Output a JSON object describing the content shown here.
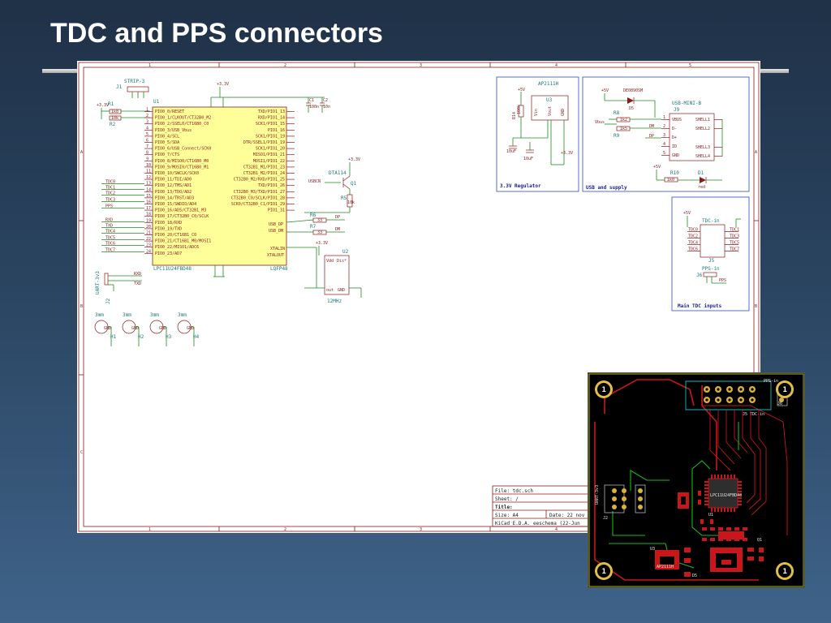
{
  "slide": {
    "title": "TDC and PPS connectors"
  },
  "schematic": {
    "mcu": {
      "ref": "U1",
      "part": "LPC11U24FBD48",
      "package": "LQFP48",
      "left_pins": [
        "PIO0_0/RESET",
        "PIO0_1/CLKOUT/CT32B0_M2",
        "PIO0_2/SSEL0/CT16B0_C0",
        "PIO0_3/USB_Vbus",
        "PIO0_4/SCL",
        "PIO0_5/SDA",
        "PIO0_6/USB_Connect/SCK0",
        "PIO0_7/CTS",
        "PIO0_8/MISO0/CT16B0_M0",
        "PIO0_9/MOSI0/CT16B0_M1",
        "PIO0_10/SWCLK/SCK0",
        "PIO0_11/TDI/AD0",
        "PIO0_12/TMS/AD1",
        "PIO0_13/TDO/AD2",
        "PIO0_14/TRST/AD3",
        "PIO0_15/SWDIO/AD4",
        "PIO0_16/AD5/CT32B1_M3",
        "PIO0_17/CT32B0_C0/SCLK",
        "PIO0_18/RXD",
        "PIO0_19/TXD",
        "PIO0_20/CT16B1_C0",
        "PIO0_21/CT16B1_M0/MOSI1",
        "PIO0_22/MISO1/ADC6",
        "PIO0_23/AD7"
      ],
      "right_pins": [
        "TXD/PIO1_13",
        "RXD/PIO1_14",
        "SCK1/PIO1_15",
        "PIO1_16",
        "SCK1/PIO1_19",
        "DTR/SSEL1/PIO1_19",
        "SCK1/PIO1_20",
        "MISO1/PIO1_21",
        "MOSI1/PIO1_22",
        "CT32B1_M1/PIO1_23",
        "CT32B1_M2/PIO1_24",
        "CT32B0_M2/RXD/PIO1_25",
        "TXD/PIO1_26",
        "CT32B0_M3/TXD/PIO1_27",
        "CT32B0_C0/SCLK/PIO1_28",
        "SCK0/CT32B0_C1/PIO1_29",
        "PIO1_31"
      ],
      "bottom_right_pins": [
        "USB_DP",
        "USB_DM",
        "XTALIN",
        "XTALOUT"
      ]
    },
    "left_nets": [
      "TDC0",
      "TDC1",
      "TDC2",
      "TDC3",
      "PPS",
      "RXD",
      "TXD",
      "TDC4",
      "TDC5",
      "TDC6",
      "TDC7"
    ],
    "strip": {
      "ref": "J1",
      "value": "STRIP-3"
    },
    "resistors": [
      {
        "ref": "R1",
        "value": "1k8"
      },
      {
        "ref": "R2",
        "value": "10k"
      },
      {
        "ref": "R5",
        "value": "10k"
      },
      {
        "ref": "R6",
        "value": "33"
      },
      {
        "ref": "R7",
        "value": "33"
      },
      {
        "ref": "R8",
        "value": "1k2"
      },
      {
        "ref": "R9",
        "value": "1k5"
      },
      {
        "ref": "R10",
        "value": "1k0"
      },
      {
        "ref": "R14",
        "value": "100k"
      }
    ],
    "capacitors": [
      {
        "ref": "C1",
        "value": "100n"
      },
      {
        "ref": "C2",
        "value": "10n"
      },
      {
        "ref": "C5",
        "value": "10uF"
      },
      {
        "ref": "C6",
        "value": "10uF"
      }
    ],
    "transistor": {
      "part": "DTA114",
      "ref": "Q1",
      "net": "USBCN"
    },
    "oscillator": {
      "ref": "U2",
      "value": "12MHz",
      "pins": [
        "Vdd",
        "Dis*",
        "out",
        "GND"
      ]
    },
    "uart": {
      "ref": "J2",
      "value": "UART-3v3",
      "nets": [
        "RXD",
        "TXD"
      ]
    },
    "holes": [
      {
        "size": "3mm",
        "ref": "H1"
      },
      {
        "size": "3mm",
        "ref": "H2"
      },
      {
        "size": "3mm",
        "ref": "H3"
      },
      {
        "size": "3mm",
        "ref": "H4"
      }
    ],
    "hole_pin": "GND",
    "regulator": {
      "part": "AP2111H",
      "ref": "U3",
      "pins": [
        "Vin",
        "Vout",
        "GND"
      ],
      "caption": "3.3V Regulator"
    },
    "usb": {
      "caption": "USB and supply",
      "connector": "USB-MINI-B",
      "ref": "J9",
      "diode": "D5",
      "diode_part": "DE0890SM",
      "led": "D1",
      "led_color": "red",
      "pins": [
        "VBUS",
        "D-",
        "D+",
        "ID",
        "GND"
      ],
      "shells": [
        "SHELL1",
        "SHELL2",
        "SHELL3",
        "SHELL4"
      ],
      "nets": [
        "Vbus",
        "DM",
        "DP"
      ]
    },
    "tdc_inputs": {
      "caption": "Main TDC inputs",
      "tdc_ref": "J5",
      "tdc_value": "TDC-in",
      "pps_ref": "J6",
      "pps_value": "PPS-in",
      "nets": [
        "TDC0",
        "TDC2",
        "TDC4",
        "TDC6",
        "TDC1",
        "TDC3",
        "TDC5",
        "TDC7",
        "PPS"
      ]
    },
    "power": {
      "v33": "+3.3V",
      "v5": "+5V",
      "vbus": "Vbus"
    },
    "title_block": {
      "file": "File: tdc.sch",
      "sheet": "Sheet: /",
      "title": "Title:",
      "size": "Size: A4",
      "date": "Date: 22 nov",
      "kicad": "KiCad E.D.A.  eeschema (22-Jun"
    },
    "border_numbers": [
      "1",
      "2",
      "3",
      "4",
      "5"
    ],
    "border_letters": [
      "A",
      "B",
      "C"
    ]
  },
  "pcb": {
    "hole_label": "1",
    "labels": {
      "pps": "PPS-in",
      "j6": "J6",
      "tdc": "J5 TDC-in",
      "mcu": "LPC11U24FBD48",
      "u1": "U1",
      "uart": "UART-3v3",
      "j2": "J2",
      "reg": "AP2111H",
      "u3": "U3",
      "d5": "D5",
      "q1": "Q1"
    }
  }
}
